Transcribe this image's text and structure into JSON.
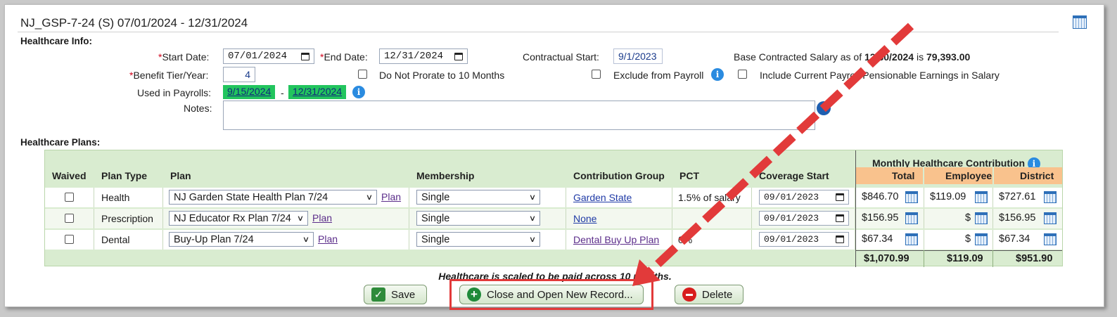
{
  "header": {
    "title": "NJ_GSP-7-24 (S) 07/01/2024 - 12/31/2024"
  },
  "healthcare_info": {
    "section_label": "Healthcare Info:",
    "required_mark": "*",
    "start_date_label": "Start Date:",
    "start_date_value": "07/01/2024",
    "end_date_label": "End Date:",
    "end_date_value": "12/31/2024",
    "contractual_start_label": "Contractual Start:",
    "contractual_start_value": "9/1/2023",
    "base_salary_prefix": "Base Contracted Salary as of",
    "base_salary_date": "12/30/2024",
    "base_salary_mid": "is",
    "base_salary_value": "79,393.00",
    "benefit_tier_label": "Benefit Tier/Year:",
    "benefit_tier_value": "4",
    "no_prorate_label": "Do Not Prorate to 10 Months",
    "exclude_payroll_label": "Exclude from Payroll",
    "include_earnings_label": "Include Current Payroll Pensionable Earnings in Salary",
    "used_in_payrolls_label": "Used in Payrolls:",
    "payroll_start": "9/15/2024",
    "payroll_dash": "-",
    "payroll_end": "12/31/2024",
    "notes_label": "Notes:"
  },
  "plans": {
    "section_label": "Healthcare Plans:",
    "monthly_header": "Monthly Healthcare Contribution",
    "columns": [
      "Waived",
      "Plan Type",
      "Plan",
      "Membership",
      "Contribution Group",
      "PCT",
      "Coverage Start",
      "Total",
      "Employee",
      "District"
    ],
    "plan_link_label": "Plan",
    "rows": [
      {
        "type": "Health",
        "plan": "NJ Garden State Health Plan 7/24",
        "membership": "Single",
        "group": "Garden State",
        "pct": "1.5% of salary",
        "coverage": "09/01/2023",
        "total": "$846.70",
        "employee": "$119.09",
        "district": "$727.61"
      },
      {
        "type": "Prescription",
        "plan": "NJ Educator Rx Plan 7/24",
        "membership": "Single",
        "group": "None",
        "pct": "",
        "coverage": "09/01/2023",
        "total": "$156.95",
        "employee": "$",
        "district": "$156.95"
      },
      {
        "type": "Dental",
        "plan": "Buy-Up Plan 7/24",
        "membership": "Single",
        "group": "Dental Buy Up Plan",
        "pct": "0%",
        "coverage": "09/01/2023",
        "total": "$67.34",
        "employee": "$",
        "district": "$67.34"
      }
    ],
    "totals": {
      "total": "$1,070.99",
      "employee": "$119.09",
      "district": "$951.90"
    },
    "scaling_note": "Healthcare is scaled to be paid across 10 months."
  },
  "buttons": {
    "save": "Save",
    "close_open": "Close and Open New Record...",
    "delete": "Delete"
  },
  "colors": {
    "highlight": "#e23a3a",
    "table_bg": "#d9ecd0",
    "payroll_pill": "#22c55e",
    "money_header": "#f9c28d"
  }
}
